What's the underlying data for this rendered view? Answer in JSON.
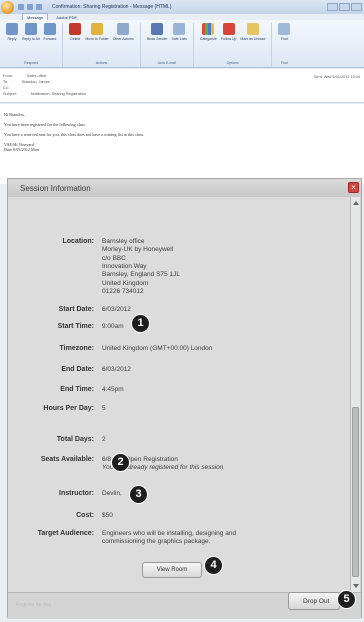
{
  "window": {
    "title": "Confirmation: Sharing Registration - Message (HTML)",
    "tabs": [
      "Message",
      "Adobe PDF"
    ]
  },
  "ribbon": {
    "groups": [
      {
        "name": "Respond",
        "buttons": [
          "Reply",
          "Reply to All",
          "Forward"
        ]
      },
      {
        "name": "Actions",
        "buttons": [
          "Delete",
          "Move to Folder",
          "Create Rule",
          "Other Actions"
        ]
      },
      {
        "name": "Junk E-mail",
        "buttons": [
          "Block Sender",
          "Safe Lists",
          "Not Junk"
        ]
      },
      {
        "name": "Options",
        "buttons": [
          "Categorize",
          "Follow Up",
          "Mark as Unread"
        ]
      },
      {
        "name": "Find",
        "buttons": [
          "Find"
        ]
      }
    ]
  },
  "email_header": {
    "from_label": "From:",
    "from_value": "Sales office",
    "to_label": "To:",
    "to_value": "Brandon, James",
    "cc_label": "Cc:",
    "subject_label": "Subject:",
    "subject_value": "Notification: Sharing Registration",
    "sent_label": "Sent:",
    "sent_value": "Wed 6/01/2012 10:44"
  },
  "email_body": {
    "greeting": "Hi Brandon,",
    "line1": "You have been registered for the following class.",
    "line2": "You have a reserved seat for you, this class does not have a waiting list at this class.",
    "venue": "VSE-Hi Vineyard",
    "date_line": "Date 6/05/2012 Mon"
  },
  "session_panel": {
    "title": "Session Information",
    "close_glyph": "×",
    "labels": {
      "location": "Location:",
      "start_date": "Start Date:",
      "start_time": "Start Time:",
      "timezone": "Timezone:",
      "end_date": "End Date:",
      "end_time": "End Time:",
      "hours_per_day": "Hours Per Day:",
      "total_days": "Total Days:",
      "seats_available": "Seats Available:",
      "instructor": "Instructor:",
      "cost": "Cost:",
      "target_audience": "Target Audience:"
    },
    "values": {
      "location": [
        "Barnsley office",
        "Morley-UK by Honeywell",
        "c/o BBC",
        "Innovation Way",
        "Barnsley, England S75 1JL",
        "United Kingdom",
        "01226 734012"
      ],
      "start_date": "6/03/2012",
      "start_time": "9:00am",
      "timezone": "United Kingdom (GMT+00:00) London",
      "end_date": "6/03/2012",
      "end_time": "4:45pm",
      "hours_per_day": "5",
      "total_days": "2",
      "seats_available": "6/8 and Open Registration",
      "seats_note": "You are already registered for this session",
      "instructor": "Devlin,",
      "cost": "$50",
      "target_audience": "Engineers who will be installing, designing and commissioning the graphics package."
    },
    "view_room_label": "View Room",
    "register_text": "Register for this",
    "drop_button_label": "Drop Out"
  },
  "callouts": [
    "1",
    "2",
    "3",
    "4",
    "5"
  ],
  "colors": {
    "callout_bg": "#1e1e1e",
    "close_red": "#d2463f"
  }
}
